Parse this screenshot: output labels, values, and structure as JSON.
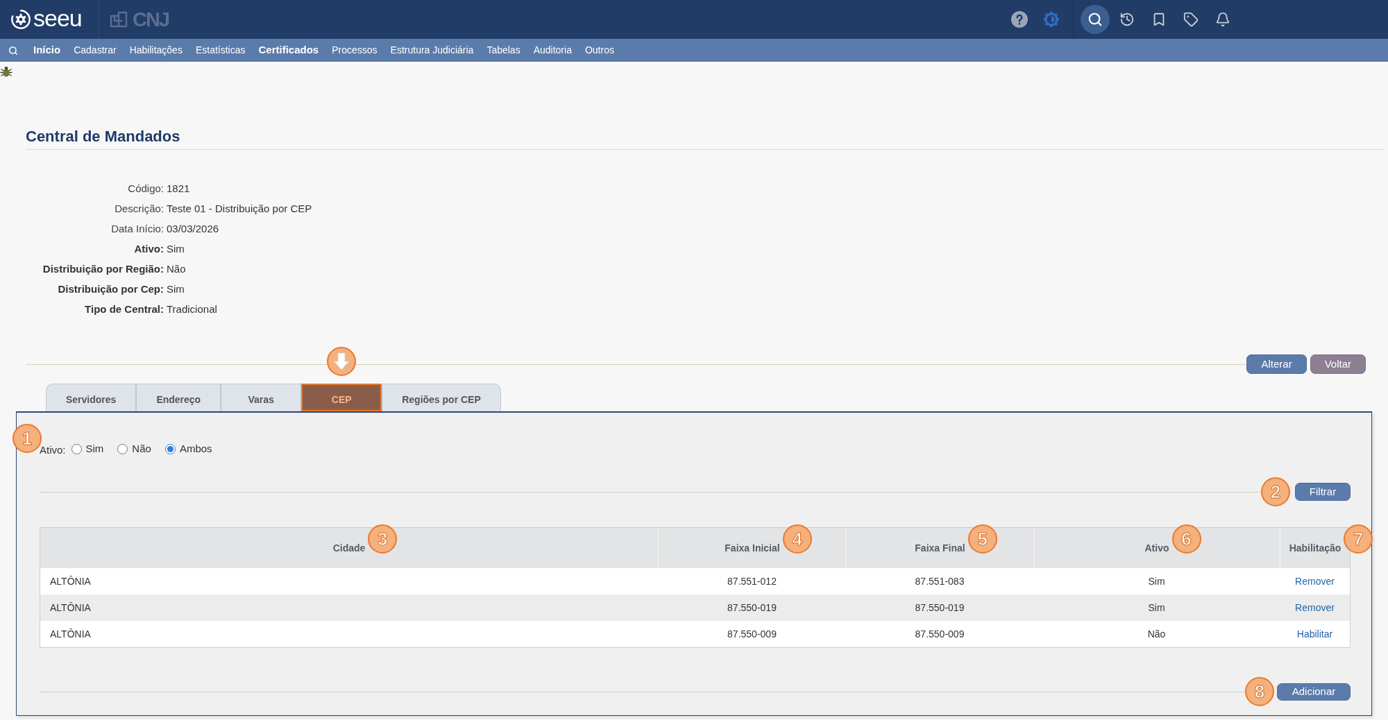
{
  "header": {
    "logo_text": "seeu",
    "partner_logo_text": "CNJ",
    "toolbar": [
      {
        "kind": "help",
        "selected": false
      },
      {
        "kind": "brightness",
        "selected": false
      },
      {
        "kind": "search",
        "selected": true
      },
      {
        "kind": "history",
        "selected": false
      },
      {
        "kind": "bookmark",
        "selected": false
      },
      {
        "kind": "tags",
        "selected": false
      },
      {
        "kind": "notifications",
        "selected": false
      }
    ]
  },
  "menu": [
    {
      "label": "Início",
      "highlighted": true
    },
    {
      "label": "Cadastrar",
      "highlighted": false
    },
    {
      "label": "Habilitações",
      "highlighted": false
    },
    {
      "label": "Estatísticas",
      "highlighted": false
    },
    {
      "label": "Certificados",
      "highlighted": true
    },
    {
      "label": "Processos",
      "highlighted": false
    },
    {
      "label": "Estrutura Judiciária",
      "highlighted": false
    },
    {
      "label": "Tabelas",
      "highlighted": false
    },
    {
      "label": "Auditoria",
      "highlighted": false
    },
    {
      "label": "Outros",
      "highlighted": false
    }
  ],
  "page": {
    "title": "Central de Mandados",
    "fields": [
      {
        "label": "Código:",
        "value": "1821",
        "bold": false
      },
      {
        "label": "Descrição:",
        "value": "Teste 01 - Distribuição por CEP",
        "bold": false
      },
      {
        "label": "Data Início:",
        "value": "03/03/2026",
        "bold": false
      },
      {
        "label": "Ativo:",
        "value": "Sim",
        "bold": true
      },
      {
        "label": "Distribuição por Região:",
        "value": "Não",
        "bold": true
      },
      {
        "label": "Distribuição por Cep:",
        "value": "Sim",
        "bold": true
      },
      {
        "label": "Tipo de Central:",
        "value": "Tradicional",
        "bold": true
      }
    ],
    "actions": [
      {
        "label": "Alterar",
        "kind": "primary"
      },
      {
        "label": "Voltar",
        "kind": "secondary"
      }
    ]
  },
  "tabs": [
    {
      "label": "Servidores",
      "selected": false,
      "pointer_callout": false
    },
    {
      "label": "Endereço",
      "selected": false,
      "pointer_callout": false
    },
    {
      "label": "Varas",
      "selected": false,
      "pointer_callout": false
    },
    {
      "label": "CEP",
      "selected": true,
      "pointer_callout": true
    },
    {
      "label": "Regiões por CEP",
      "selected": false,
      "pointer_callout": false
    }
  ],
  "filter": {
    "label": "Ativo:",
    "callout": "1",
    "options": [
      {
        "label": "Sim",
        "selected": false
      },
      {
        "label": "Não",
        "selected": false
      },
      {
        "label": "Ambos",
        "selected": true
      }
    ],
    "button": {
      "label": "Filtrar",
      "callout": "2"
    }
  },
  "table": {
    "columns": [
      {
        "label": "Cidade",
        "callout": "3"
      },
      {
        "label": "Faixa Inicial",
        "callout": "4"
      },
      {
        "label": "Faixa Final",
        "callout": "5"
      },
      {
        "label": "Ativo",
        "callout": "6"
      },
      {
        "label": "Habilitação",
        "callout": "7"
      }
    ],
    "rows": [
      [
        "ALTÔNIA",
        "87.551-012",
        "87.551-083",
        "Sim",
        "Remover"
      ],
      [
        "ALTÔNIA",
        "87.550-019",
        "87.550-019",
        "Sim",
        "Remover"
      ],
      [
        "ALTÔNIA",
        "87.550-009",
        "87.550-009",
        "Não",
        "Habilitar"
      ]
    ]
  },
  "add_button": {
    "label": "Adicionar",
    "callout": "8"
  }
}
